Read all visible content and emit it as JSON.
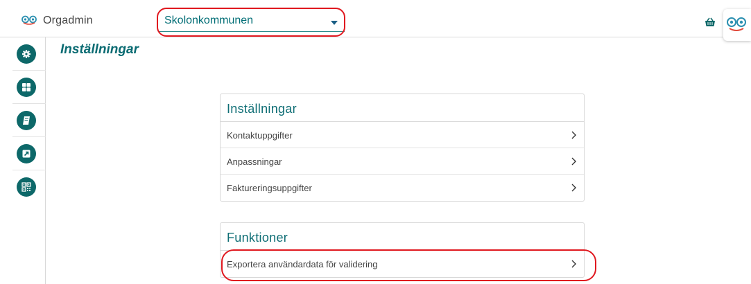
{
  "app": {
    "name": "Orgadmin"
  },
  "org_select": {
    "value": "Skolonkommunen"
  },
  "page": {
    "title": "Inställningar"
  },
  "sidebar": {
    "items": [
      {
        "icon": "gear-icon"
      },
      {
        "icon": "grid-icon"
      },
      {
        "icon": "book-icon"
      },
      {
        "icon": "external-link-icon"
      },
      {
        "icon": "qr-code-icon"
      }
    ]
  },
  "settings_card": {
    "title": "Inställningar",
    "rows": [
      {
        "label": "Kontaktuppgifter"
      },
      {
        "label": "Anpassningar"
      },
      {
        "label": "Faktureringsuppgifter"
      }
    ]
  },
  "functions_card": {
    "title": "Funktioner",
    "rows": [
      {
        "label": "Exportera användardata för validering"
      }
    ]
  },
  "colors": {
    "accent": "#0d6869",
    "title_teal": "#0a6b72",
    "highlight_red": "#e0181f"
  }
}
